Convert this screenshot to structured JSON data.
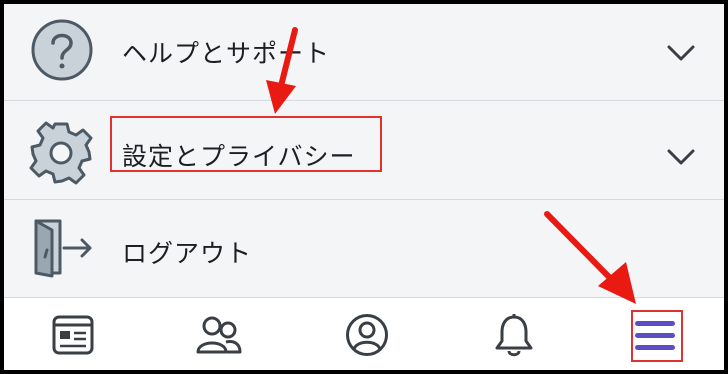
{
  "menu": {
    "items": [
      {
        "id": "help",
        "label": "ヘルプとサポート",
        "icon": "help-circle-icon",
        "expandable": true
      },
      {
        "id": "settings",
        "label": "設定とプライバシー",
        "icon": "gear-icon",
        "expandable": true,
        "highlighted": true
      },
      {
        "id": "logout",
        "label": "ログアウト",
        "icon": "logout-door-icon",
        "expandable": false
      }
    ]
  },
  "tabbar": {
    "tabs": [
      {
        "id": "news-feed",
        "icon": "news-feed-icon"
      },
      {
        "id": "friends",
        "icon": "friends-icon"
      },
      {
        "id": "profile",
        "icon": "profile-icon"
      },
      {
        "id": "notifications",
        "icon": "bell-icon"
      },
      {
        "id": "menu",
        "icon": "hamburger-menu-icon",
        "active": true,
        "highlighted": true
      }
    ]
  },
  "colors": {
    "background": "#f4f5f7",
    "text": "#1c1e21",
    "icon": "#5b6670",
    "active_tab": "#5b4ec4",
    "annotation": "#e0322e"
  }
}
